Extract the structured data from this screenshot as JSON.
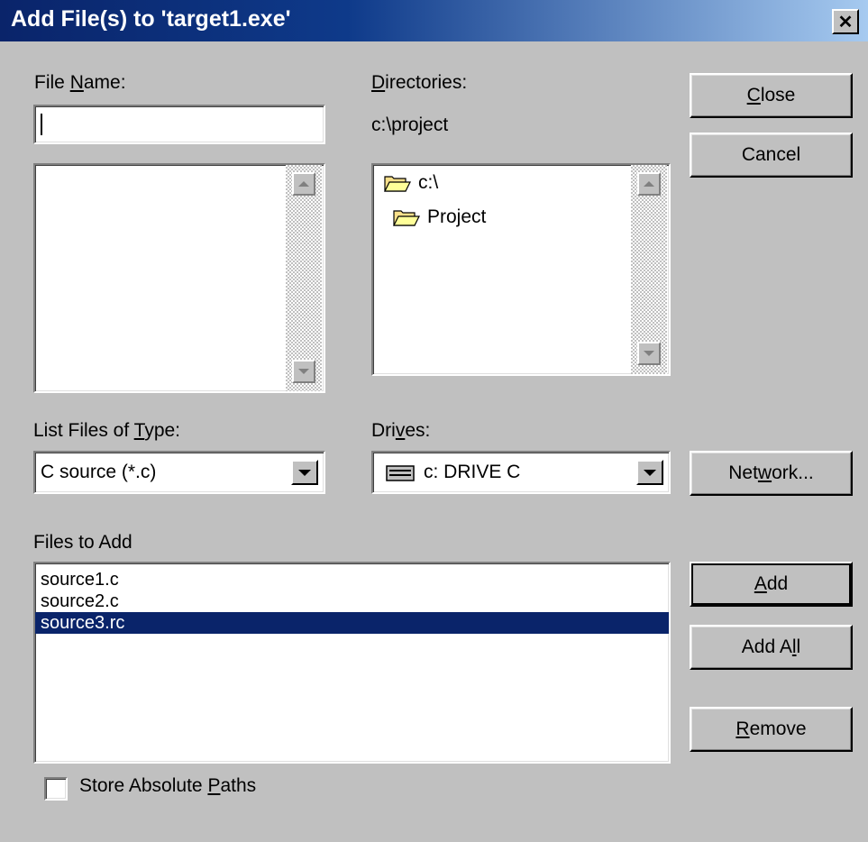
{
  "window": {
    "title": "Add File(s) to 'target1.exe'",
    "close_glyph": "✕"
  },
  "file_name": {
    "label_pre": "File ",
    "label_u": "N",
    "label_post": "ame:",
    "value": ""
  },
  "directories": {
    "label_pre": "",
    "label_u": "D",
    "label_post": "irectories:",
    "current_path": "c:\\project",
    "items": [
      {
        "label": "c:\\",
        "icon": "open-folder-icon"
      },
      {
        "label": "Project",
        "icon": "open-folder-icon"
      }
    ]
  },
  "buttons": {
    "close": {
      "pre": "",
      "u": "C",
      "post": "lose"
    },
    "cancel": {
      "label": "Cancel"
    },
    "network": {
      "pre": "Net",
      "u": "w",
      "post": "ork..."
    },
    "add": {
      "pre": "",
      "u": "A",
      "post": "dd"
    },
    "add_all": {
      "pre": "Add A",
      "u": "l",
      "post": "l"
    },
    "remove": {
      "pre": "",
      "u": "R",
      "post": "emove"
    }
  },
  "file_type": {
    "label_pre": "List Files of ",
    "label_u": "T",
    "label_post": "ype:",
    "selected": "C source (*.c)"
  },
  "drives": {
    "label_pre": "Dri",
    "label_u": "v",
    "label_post": "es:",
    "selected": "c: DRIVE C",
    "icon": "drive-icon"
  },
  "files_to_add": {
    "label": "Files to Add",
    "items": [
      "source1.c",
      "source2.c",
      "source3.rc"
    ],
    "selected_index": 2
  },
  "store_paths": {
    "label_pre": "Store Absolute ",
    "label_u": "P",
    "label_post": "aths",
    "checked": false
  },
  "colors": {
    "face": "#c0c0c0",
    "selection": "#0a246a",
    "title_start": "#0a246a"
  }
}
